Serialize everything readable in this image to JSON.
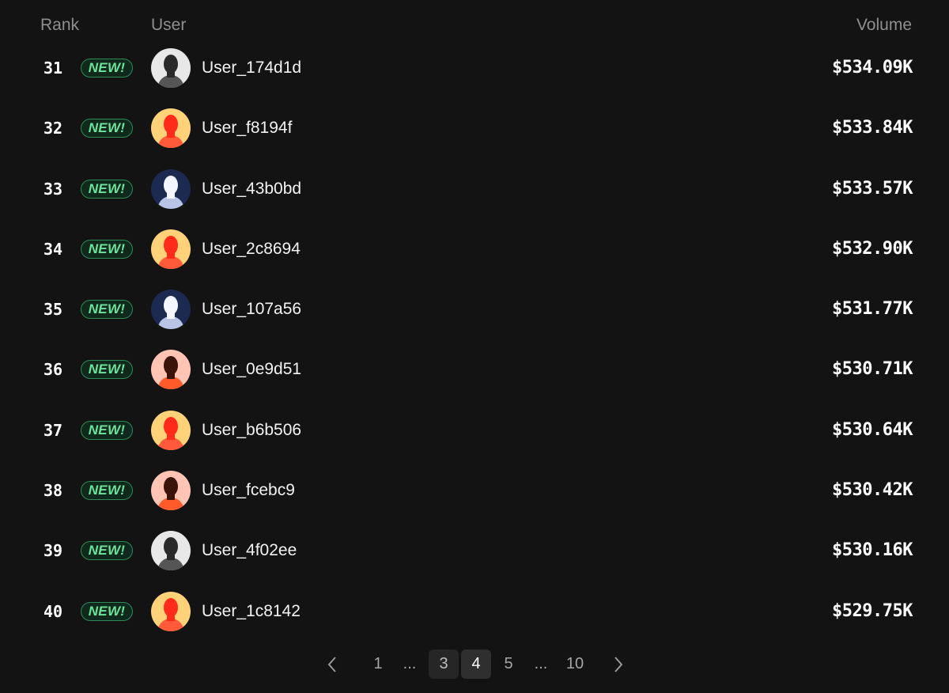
{
  "header": {
    "rank": "Rank",
    "user": "User",
    "volume": "Volume"
  },
  "badge_text": "NEW!",
  "rows": [
    {
      "rank": "31",
      "user": "User_174d1d",
      "volume": "$534.09K",
      "avatar": "gray-silhouette-avatar"
    },
    {
      "rank": "32",
      "user": "User_f8194f",
      "volume": "$533.84K",
      "avatar": "red-on-yellow-avatar"
    },
    {
      "rank": "33",
      "user": "User_43b0bd",
      "volume": "$533.57K",
      "avatar": "white-on-navy-avatar"
    },
    {
      "rank": "34",
      "user": "User_2c8694",
      "volume": "$532.90K",
      "avatar": "red-on-yellow-avatar"
    },
    {
      "rank": "35",
      "user": "User_107a56",
      "volume": "$531.77K",
      "avatar": "white-on-navy-avatar"
    },
    {
      "rank": "36",
      "user": "User_0e9d51",
      "volume": "$530.71K",
      "avatar": "dark-on-peach-avatar"
    },
    {
      "rank": "37",
      "user": "User_b6b506",
      "volume": "$530.64K",
      "avatar": "red-on-yellow-avatar"
    },
    {
      "rank": "38",
      "user": "User_fcebc9",
      "volume": "$530.42K",
      "avatar": "dark-on-peach-avatar"
    },
    {
      "rank": "39",
      "user": "User_4f02ee",
      "volume": "$530.16K",
      "avatar": "gray-silhouette-avatar"
    },
    {
      "rank": "40",
      "user": "User_1c8142",
      "volume": "$529.75K",
      "avatar": "red-on-yellow-avatar"
    }
  ],
  "pagination": {
    "prev_icon": "chevron-left-icon",
    "next_icon": "chevron-right-icon",
    "pages": [
      "1",
      "...",
      "3",
      "4",
      "5",
      "...",
      "10"
    ],
    "current": "4"
  },
  "colors": {
    "background": "#131313",
    "badge_text": "#6ee29a",
    "badge_border": "#2f8a57",
    "muted": "#8f8f8f"
  }
}
